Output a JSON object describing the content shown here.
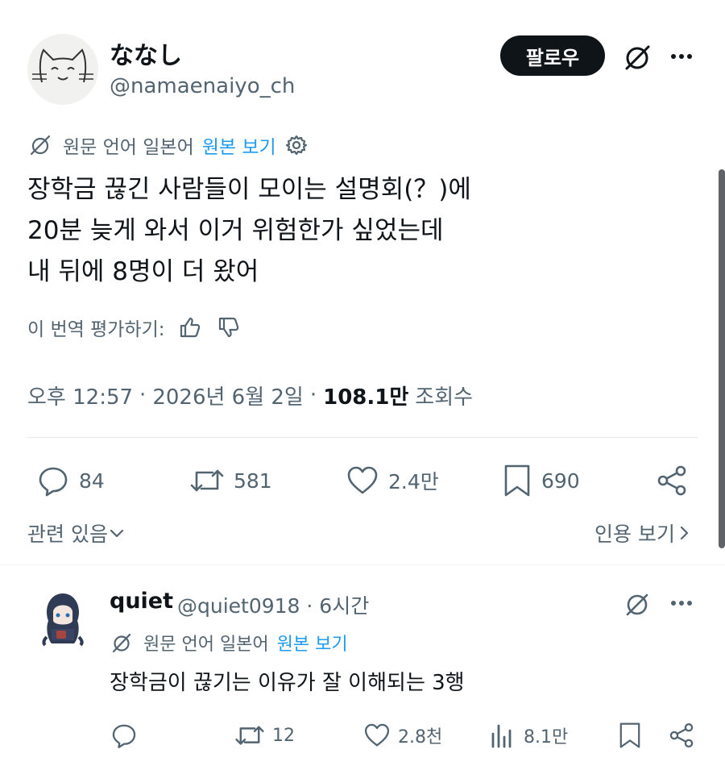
{
  "post": {
    "author": {
      "display_name": "ななし",
      "handle": "@namaenaiyo_ch"
    },
    "follow_label": "팔로우",
    "translation": {
      "note": "원문 언어 일본어",
      "view_original": "원본 보기"
    },
    "body_lines": [
      "장학금 끊긴 사람들이 모이는 설명회(？)에",
      "20분 늦게 와서 이거 위험한가 싶었는데",
      "내 뒤에 8명이 더 왔어"
    ],
    "rate_label": "이 번역 평가하기:",
    "meta": {
      "time": "오후 12:57",
      "date": "2026년 6월 2일",
      "views_count": "108.1만",
      "views_label": "조회수",
      "separator": "·"
    },
    "stats": {
      "replies": "84",
      "reposts": "581",
      "likes": "2.4만",
      "bookmarks": "690"
    },
    "related_label": "관련 있음",
    "quotes_label": "인용 보기"
  },
  "reply": {
    "name": "quiet",
    "handle_time": "@quiet0918 · 6시간",
    "translation": {
      "note": "원문 언어 일본어",
      "view_original": "원본 보기"
    },
    "body": "장학금이 끊기는 이유가 잘 이해되는 3행",
    "stats": {
      "replies": "",
      "reposts": "12",
      "likes": "2.8천",
      "views": "8.1만"
    }
  },
  "icons": {
    "grok": "grok-icon",
    "more": "more-icon",
    "gear": "gear-icon",
    "thumbs_up": "thumbs-up-icon",
    "thumbs_down": "thumbs-down-icon",
    "reply": "reply-icon",
    "repost": "repost-icon",
    "like": "heart-icon",
    "bookmark": "bookmark-icon",
    "share": "share-icon",
    "views": "views-icon"
  },
  "colors": {
    "text": "#0f1419",
    "secondary": "#536471",
    "link": "#1d9bf0",
    "button": "#0f1419"
  }
}
